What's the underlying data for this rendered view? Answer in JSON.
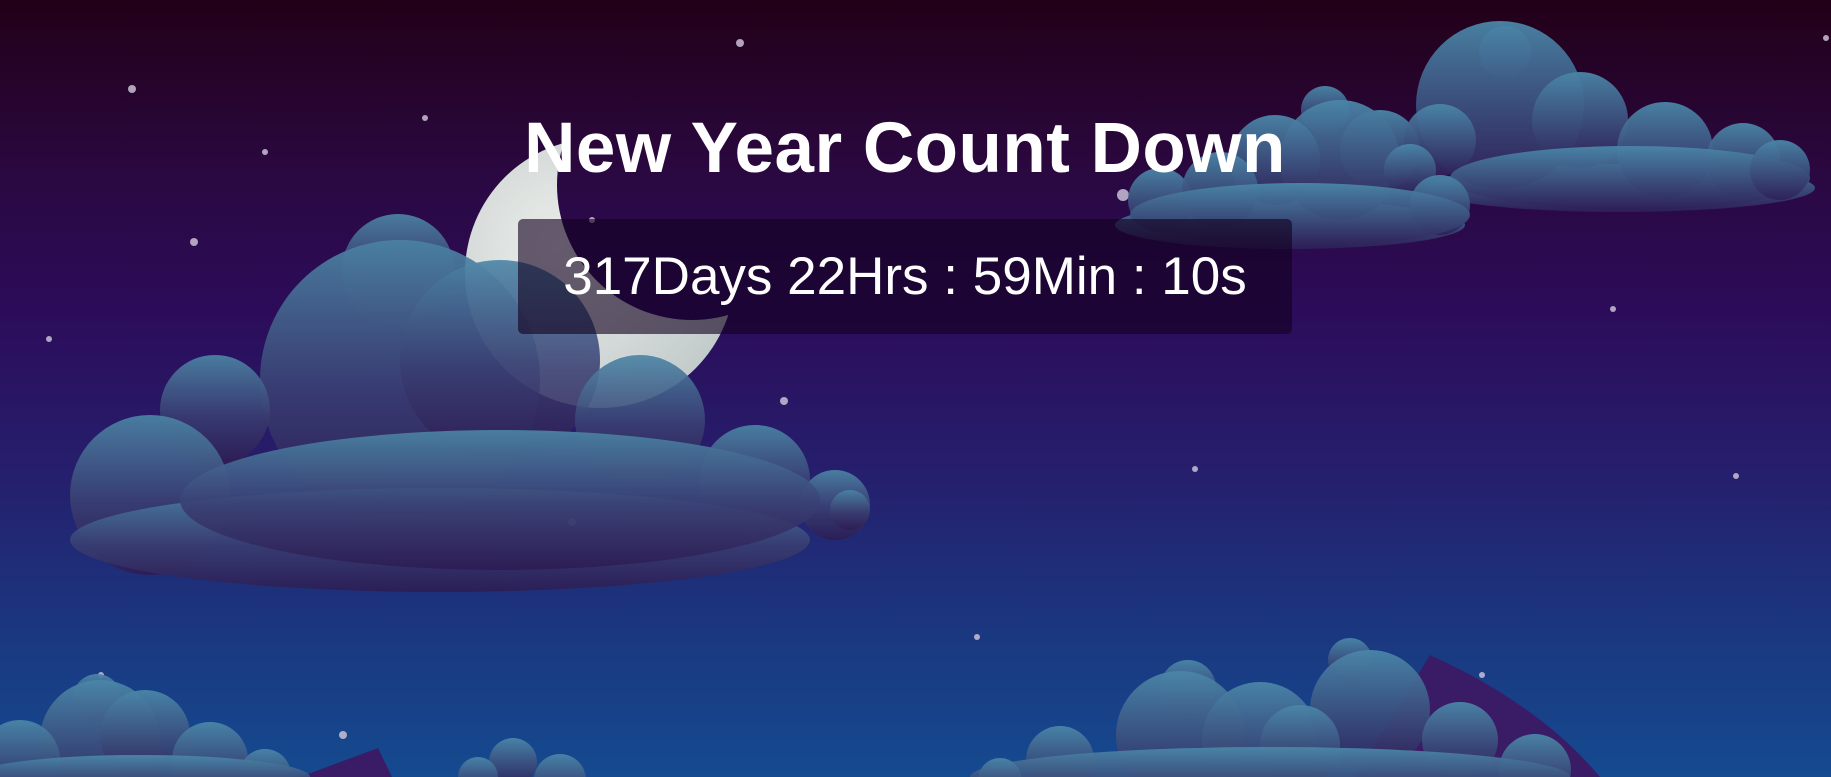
{
  "page": {
    "title": "New Year Count Down"
  },
  "countdown": {
    "days": "317",
    "days_unit": "Days",
    "hours": "22",
    "hours_unit": "Hrs",
    "separator": " : ",
    "minutes": "59",
    "minutes_unit": "Min",
    "seconds": "10",
    "seconds_unit": "s"
  },
  "colors": {
    "sky_top": "#220018",
    "sky_middle": "#2c0c5a",
    "sky_bottom": "#154a90",
    "cloud_light": "#4a82a4",
    "cloud_dark": "#30204f",
    "moon": "#dfe6e0",
    "text": "#ffffff"
  },
  "icons": {
    "moon": "crescent-moon-icon",
    "cloud": "cloud-icon",
    "star": "star-icon"
  }
}
